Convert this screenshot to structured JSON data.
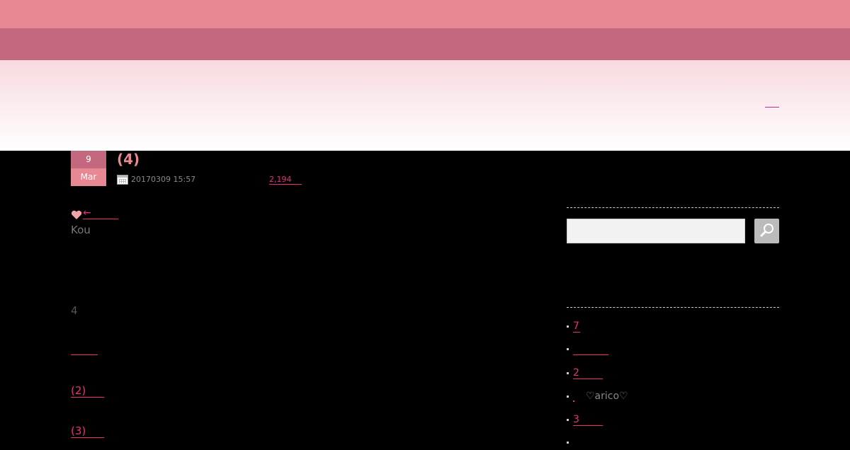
{
  "post": {
    "date_day": "9",
    "date_month": "Mar",
    "title": "(4)",
    "date": "20170309 15:57",
    "views": "2,194"
  },
  "content": {
    "arrow_link": "←",
    "author": "Kou",
    "number": "4",
    "part_links": [
      "(2)",
      "(3)"
    ]
  },
  "sidebar": {
    "items": [
      {
        "label": "7"
      },
      {
        "label": ""
      },
      {
        "label": "2"
      },
      {
        "text": "♡arico♡"
      },
      {
        "label": "3"
      },
      {
        "label": ""
      }
    ]
  },
  "colors": {
    "accent": "#e8307e",
    "pink_light": "#e88892",
    "pink_dark": "#c4687f"
  }
}
